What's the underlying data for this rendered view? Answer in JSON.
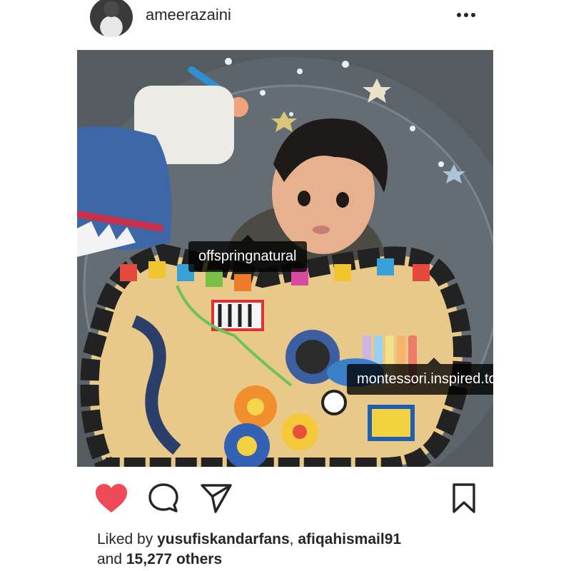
{
  "post": {
    "username": "ameerazaini",
    "tags": [
      "offspringnatural",
      "montessori.inspired.toys"
    ],
    "liked": true,
    "likes": {
      "prefix": "Liked by ",
      "user1": "yusufiskandarfans",
      "separator": ", ",
      "user2": "afiqahismail91",
      "and": "and ",
      "count": "15,277 others"
    },
    "icons": {
      "more": "more-options-icon",
      "like": "heart-icon",
      "comment": "comment-icon",
      "share": "send-icon",
      "save": "bookmark-icon"
    },
    "colors": {
      "heart": "#ed4956",
      "text": "#262626"
    }
  }
}
